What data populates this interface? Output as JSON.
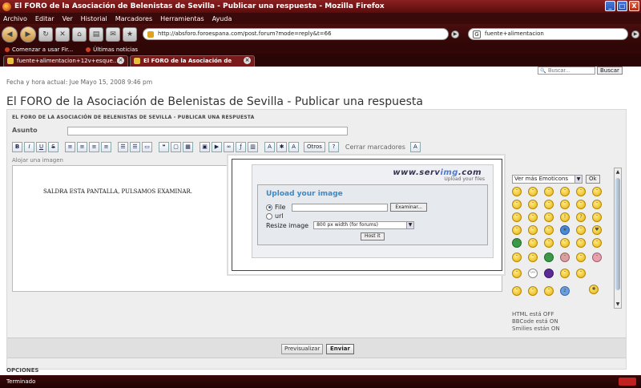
{
  "window": {
    "title": "El FORO de la Asociación de Belenistas de Sevilla - Publicar una respuesta - Mozilla Firefox",
    "controls": {
      "minimize": "_",
      "maximize": "□",
      "close": "X"
    }
  },
  "menu": [
    "Archivo",
    "Editar",
    "Ver",
    "Historial",
    "Marcadores",
    "Herramientas",
    "Ayuda"
  ],
  "nav": {
    "url": "http://absforo.foroespana.com/post.forum?mode=reply&t=66",
    "search_value": "fuente+alimentacion"
  },
  "bookmarks": [
    "Comenzar a usar Fir...",
    "Últimas noticias"
  ],
  "tabs": [
    {
      "label": "fuente+alimentacion+12v+esque...",
      "active": false
    },
    {
      "label": "El FORO de la Asociación de Belen...",
      "active": true
    }
  ],
  "page": {
    "search_placeholder": "Buscar...",
    "search_button": "Buscar",
    "date_line": "Fecha y hora actual: Jue Mayo 15, 2008 9:46 pm",
    "title": "El FORO de la Asociación de Belenistas de Sevilla - Publicar una respuesta",
    "panel_header": "EL FORO DE LA ASOCIACIÓN DE BELENISTAS DE SEVILLA - PUBLICAR UNA RESPUESTA",
    "subject_label": "Asunto",
    "toolbar": {
      "bold": "B",
      "italic": "I",
      "underline": "U",
      "strike": "S",
      "otros": "Otros",
      "cerrar": "Cerrar marcadores"
    },
    "image_link": "Alojar una imagen",
    "editor_text": "SALDRA ESTA PANTALLA, PULSAMOS EXAMINAR.",
    "upload": {
      "logo_left": "www.serv",
      "logo_accent": "img",
      "logo_right": ".com",
      "tagline": "Upload your files",
      "title": "Upload your image",
      "file_label": "File",
      "url_label": "url",
      "browse_button": "Examinar...",
      "resize_label": "Resize image",
      "resize_value": "800 px width (for forums)",
      "host_button": "Host it"
    },
    "emoticons": {
      "select_value": "Ver más Emoticons",
      "ok": "Ok"
    },
    "status_lines": [
      "HTML está OFF",
      "BBCode está ON",
      "Smilies están ON"
    ],
    "preview_button": "Previsualizar",
    "send_button": "Enviar",
    "options_header": "OPCIONES"
  },
  "statusbar": {
    "text": "Terminado"
  }
}
